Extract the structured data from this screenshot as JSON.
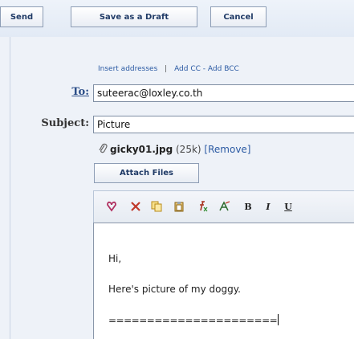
{
  "toolbar": {
    "send_label": "Send",
    "draft_label": "Save as a Draft",
    "cancel_label": "Cancel"
  },
  "compose": {
    "insert_addresses": "Insert addresses",
    "separator": "|",
    "add_cc": "Add CC",
    "cc_bcc_separator": "-",
    "add_bcc": "Add BCC",
    "to_label": "To:",
    "to_value": "suteerac@loxley.co.th",
    "subject_label": "Subject:",
    "subject_value": "Picture",
    "attachment": {
      "file_name": "gicky01.jpg",
      "file_size": "(25k)",
      "remove_label": "[Remove]"
    },
    "attach_button_label": "Attach Files"
  },
  "format_toolbar": {
    "icons": [
      "spellcheck-icon",
      "cut-icon",
      "copy-icon",
      "paste-icon",
      "font-icon",
      "text-color-icon",
      "bold-icon",
      "italic-icon",
      "underline-icon"
    ],
    "bold_glyph": "B",
    "italic_glyph": "I",
    "underline_glyph": "U"
  },
  "message": {
    "lines": [
      "Hi,",
      "Here's picture of my doggy.",
      "======================"
    ]
  }
}
